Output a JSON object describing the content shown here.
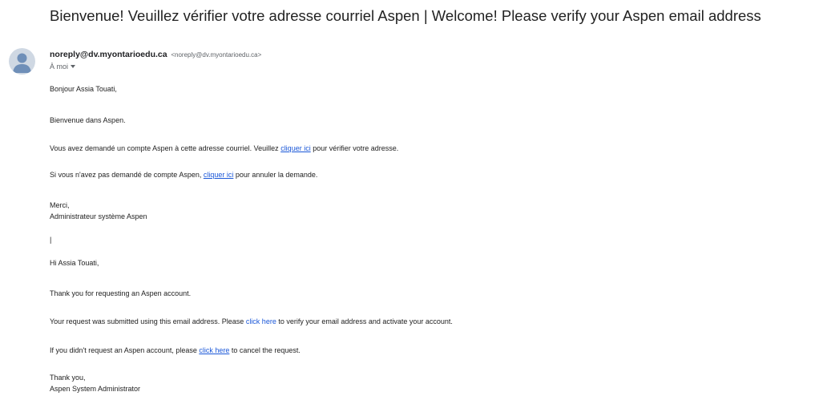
{
  "email": {
    "subject": "Bienvenue! Veuillez vérifier votre adresse courriel Aspen | Welcome! Please verify your Aspen email address",
    "sender_name": "noreply@dv.myontarioedu.ca",
    "sender_email": "<noreply@dv.myontarioedu.ca>",
    "to_label": "À moi",
    "avatar_icon": "person-icon",
    "link_color": "#1a57d8"
  },
  "body_fr": {
    "greeting": "Bonjour Assia Touati,",
    "welcome": "Bienvenue dans Aspen.",
    "verify_before": "Vous avez demandé un compte Aspen à cette adresse courriel. Veuillez ",
    "verify_link": "cliquer ici",
    "verify_after": " pour vérifier votre adresse.",
    "cancel_before": "Si vous n'avez pas demandé de compte Aspen, ",
    "cancel_link": "cliquer ici",
    "cancel_after": " pour annuler la demande.",
    "thanks": "Merci,",
    "signature": "Administrateur système Aspen"
  },
  "separator": "|",
  "body_en": {
    "greeting": "Hi Assia Touati,",
    "thanks_request": "Thank you for requesting an Aspen account.",
    "verify_before": "Your request was submitted using this email address. Please ",
    "verify_link": "click here",
    "verify_after": " to verify your email address and activate your account.",
    "cancel_before": "If you didn't request an Aspen account, please ",
    "cancel_link": "click here",
    "cancel_after": " to cancel the request.",
    "thanks": "Thank you,",
    "signature": "Aspen System Administrator"
  }
}
